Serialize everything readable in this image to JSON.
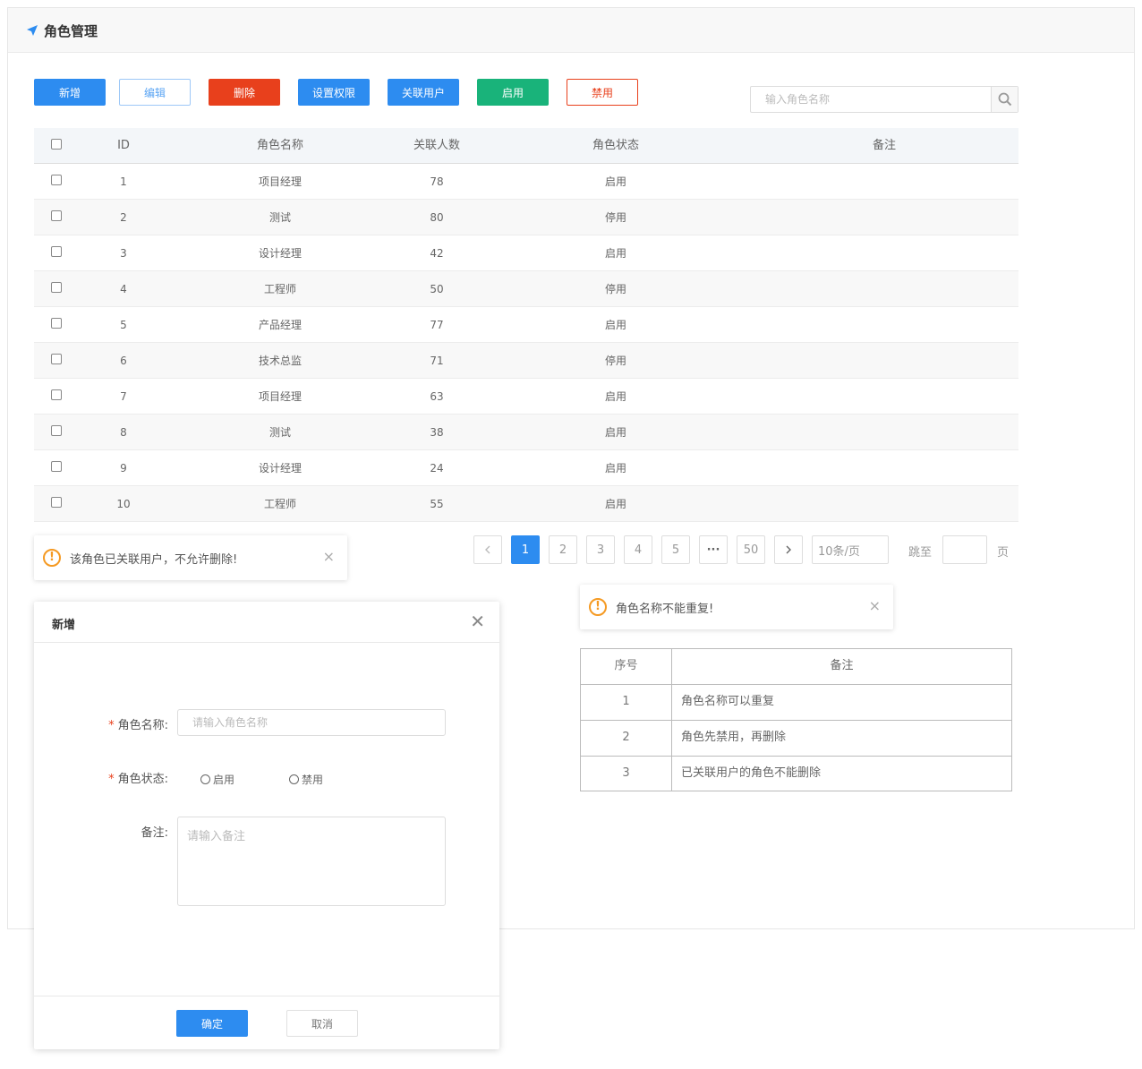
{
  "page": {
    "title": "角色管理"
  },
  "toolbar": {
    "add": "新增",
    "edit": "编辑",
    "delete": "删除",
    "permissions": "设置权限",
    "link_users": "关联用户",
    "enable": "启用",
    "disable": "禁用"
  },
  "search": {
    "placeholder": "输入角色名称",
    "value": ""
  },
  "table": {
    "headers": {
      "id": "ID",
      "name": "角色名称",
      "count": "关联人数",
      "status": "角色状态",
      "remark": "备注"
    },
    "rows": [
      {
        "id": "1",
        "name": "项目经理",
        "count": "78",
        "status": "启用",
        "remark": ""
      },
      {
        "id": "2",
        "name": "测试",
        "count": "80",
        "status": "停用",
        "remark": ""
      },
      {
        "id": "3",
        "name": "设计经理",
        "count": "42",
        "status": "启用",
        "remark": ""
      },
      {
        "id": "4",
        "name": "工程师",
        "count": "50",
        "status": "停用",
        "remark": ""
      },
      {
        "id": "5",
        "name": "产品经理",
        "count": "77",
        "status": "启用",
        "remark": ""
      },
      {
        "id": "6",
        "name": "技术总监",
        "count": "71",
        "status": "停用",
        "remark": ""
      },
      {
        "id": "7",
        "name": "项目经理",
        "count": "63",
        "status": "启用",
        "remark": ""
      },
      {
        "id": "8",
        "name": "测试",
        "count": "38",
        "status": "启用",
        "remark": ""
      },
      {
        "id": "9",
        "name": "设计经理",
        "count": "24",
        "status": "启用",
        "remark": ""
      },
      {
        "id": "10",
        "name": "工程师",
        "count": "55",
        "status": "启用",
        "remark": ""
      }
    ]
  },
  "toasts": {
    "delete_warning": "该角色已关联用户，不允许删除!",
    "duplicate_warning": "角色名称不能重复!"
  },
  "pagination": {
    "pages": [
      "1",
      "2",
      "3",
      "4",
      "5"
    ],
    "ellipsis": "···",
    "last": "50",
    "current": "1",
    "page_size": "10条/页",
    "jump_label": "跳至",
    "jump_value": "",
    "page_unit": "页"
  },
  "dialog": {
    "title": "新增",
    "name_label": "角色名称:",
    "name_placeholder": "请输入角色名称",
    "status_label": "角色状态:",
    "status_options": [
      "启用",
      "禁用"
    ],
    "remark_label": "备注:",
    "remark_placeholder": "请输入备注",
    "ok": "确定",
    "cancel": "取消"
  },
  "notes": {
    "headers": {
      "index": "序号",
      "remark": "备注"
    },
    "rows": [
      {
        "index": "1",
        "remark": "角色名称可以重复"
      },
      {
        "index": "2",
        "remark": "角色先禁用，再删除"
      },
      {
        "index": "3",
        "remark": "已关联用户的角色不能删除"
      }
    ]
  },
  "colors": {
    "primary": "#2d8cf0",
    "danger": "#e8401c",
    "success": "#19b37a",
    "warning": "#f59a23"
  }
}
